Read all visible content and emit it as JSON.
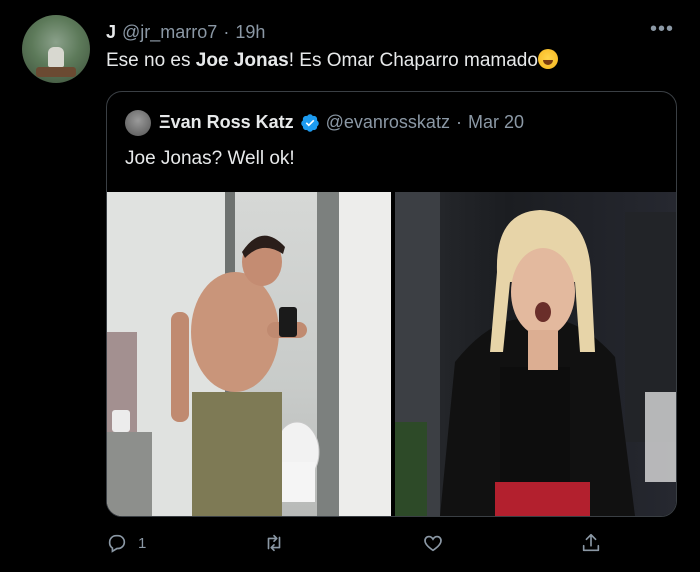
{
  "tweet": {
    "author_name": "J",
    "author_handle": "@jr_marro7",
    "separator": "·",
    "time": "19h",
    "text_before": "Ese no es ",
    "text_bold": "Joe Jonas",
    "text_after": "! Es Omar Chaparro mamado",
    "emoji_name": "rolling-on-floor-laughing-emoji"
  },
  "quoted": {
    "author_name": "Ξvan Ross Katz",
    "verified": true,
    "author_handle": "@evanrosskatz",
    "separator": "·",
    "date": "Mar 20",
    "text": "Joe Jonas? Well ok!"
  },
  "actions": {
    "reply_count": "1",
    "retweet_count": "",
    "like_count": ""
  },
  "colors": {
    "background": "#000000",
    "text": "#e7e9ea",
    "muted": "#8b98a5",
    "border": "#3a3f44",
    "verified": "#1d9bf0"
  },
  "icons": [
    "more-icon",
    "verified-icon",
    "reply-icon",
    "retweet-icon",
    "like-icon",
    "share-icon"
  ]
}
